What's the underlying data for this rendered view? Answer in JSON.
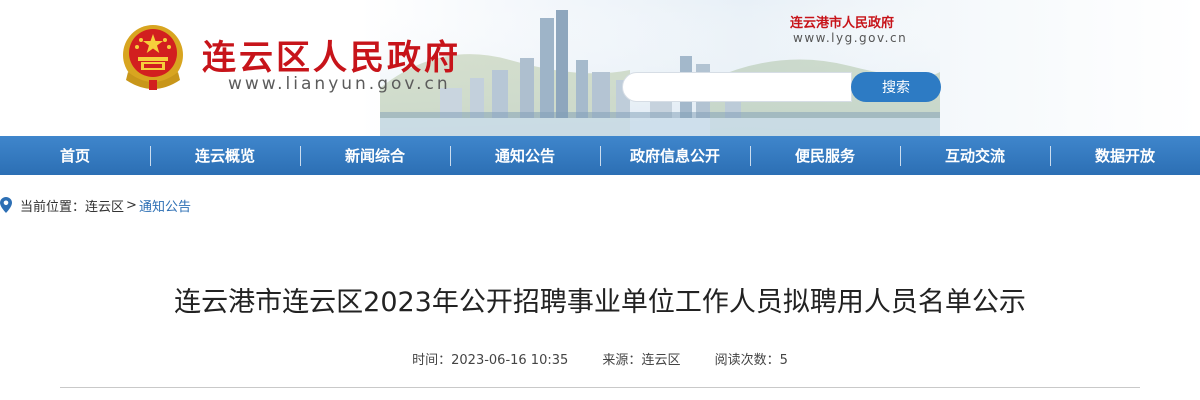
{
  "header": {
    "site_title": "连云区人民政府",
    "site_url": "www.lianyun.gov.cn",
    "parent_site": {
      "label": "连云港市人民政府",
      "url": "www.lyg.gov.cn"
    },
    "search": {
      "placeholder": "",
      "button_label": "搜索"
    }
  },
  "nav": {
    "items": [
      {
        "label": "首页"
      },
      {
        "label": "连云概览"
      },
      {
        "label": "新闻综合"
      },
      {
        "label": "通知公告"
      },
      {
        "label": "政府信息公开"
      },
      {
        "label": "便民服务"
      },
      {
        "label": "互动交流"
      },
      {
        "label": "数据开放"
      }
    ]
  },
  "breadcrumb": {
    "prefix": "当前位置：",
    "items": [
      {
        "label": "连云区"
      },
      {
        "label": "通知公告"
      }
    ],
    "separator": ">"
  },
  "article": {
    "title": "连云港市连云区2023年公开招聘事业单位工作人员拟聘用人员名单公示",
    "meta": {
      "time_label": "时间：",
      "time_value": "2023-06-16 10:35",
      "source_label": "来源：",
      "source_value": "连云区",
      "views_label": "阅读次数：",
      "views_value": "5"
    }
  },
  "colors": {
    "brand_red": "#c7141a",
    "nav_blue": "#3a7fc4",
    "search_button": "#2d7bc4",
    "breadcrumb_current": "#2d6fb4"
  },
  "icons": {
    "emblem": "national-emblem-icon",
    "location": "location-pin-icon"
  }
}
